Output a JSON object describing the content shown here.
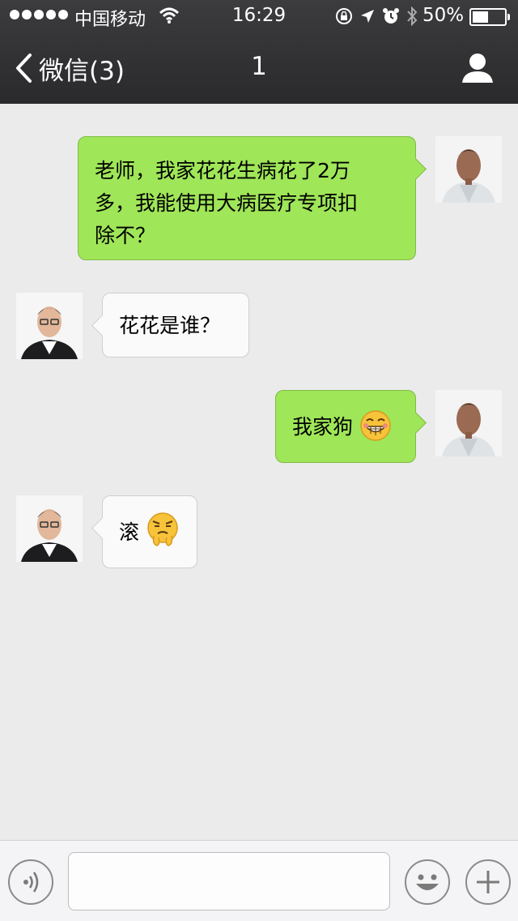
{
  "status_bar": {
    "carrier": "中国移动",
    "time": "16:29",
    "battery_percent": "50%",
    "battery_level": 0.5,
    "icons": [
      "signal-dots-icon",
      "wifi-icon",
      "orientation-lock-icon",
      "location-arrow-icon",
      "alarm-icon",
      "bluetooth-icon",
      "battery-icon"
    ]
  },
  "nav_bar": {
    "back_label": "微信(3)",
    "title": "1",
    "right_icon": "person-icon"
  },
  "messages": [
    {
      "side": "outgoing",
      "text": "老师，我家花花生病花了2万多，我能使用大病医疗专项扣除不？",
      "lines": [
        "老师，我家花花生病花了2万",
        "多，我能使用大病医疗专项扣",
        "除不？"
      ],
      "emoji": null
    },
    {
      "side": "incoming",
      "text": "花花是谁？",
      "emoji": null
    },
    {
      "side": "outgoing",
      "text": "我家狗",
      "emoji": "grin-emoji"
    },
    {
      "side": "incoming",
      "text": "滚",
      "emoji": "angry-snort-emoji"
    }
  ],
  "input_bar": {
    "left_icon": "voice-icon",
    "input_value": "",
    "input_placeholder": "",
    "right_icons": [
      "emoji-face-icon",
      "plus-icon"
    ]
  },
  "colors": {
    "nav_bg": "#2f2f31",
    "chat_bg": "#ebebeb",
    "outgoing_bubble": "#9fe658",
    "incoming_bubble": "#fafafa",
    "input_bar_bg": "#f4f4f6"
  }
}
